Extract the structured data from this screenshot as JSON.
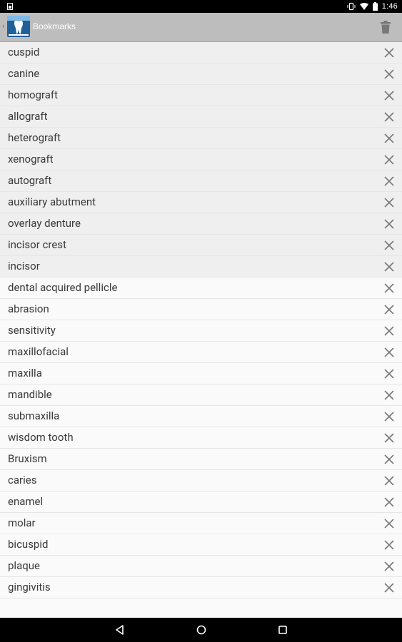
{
  "status_bar": {
    "time": "1:46"
  },
  "action_bar": {
    "title": "Bookmarks",
    "back_glyph": "‹"
  },
  "bookmarks": [
    "cuspid",
    "canine",
    "homograft",
    "allograft",
    "heterograft",
    "xenograft",
    "autograft",
    "auxiliary abutment",
    "overlay denture",
    "incisor crest",
    "incisor",
    "dental acquired pellicle",
    "abrasion",
    "sensitivity",
    "maxillofacial",
    "maxilla",
    "mandible",
    "submaxilla",
    "wisdom tooth",
    "Bruxism",
    "caries",
    "enamel",
    "molar",
    "bicuspid",
    "plaque",
    "gingivitis"
  ],
  "icons": {
    "app": "tooth-app-icon",
    "delete_all": "trash-icon",
    "delete_item": "close-icon",
    "nav": [
      "back-nav-icon",
      "home-nav-icon",
      "recents-nav-icon"
    ]
  },
  "colors": {
    "action_bar": "#bdbdbd",
    "list_bg": "#fafafa",
    "row_shaded": "#efefef",
    "text": "#3a3a3a",
    "icon": "#777777"
  }
}
